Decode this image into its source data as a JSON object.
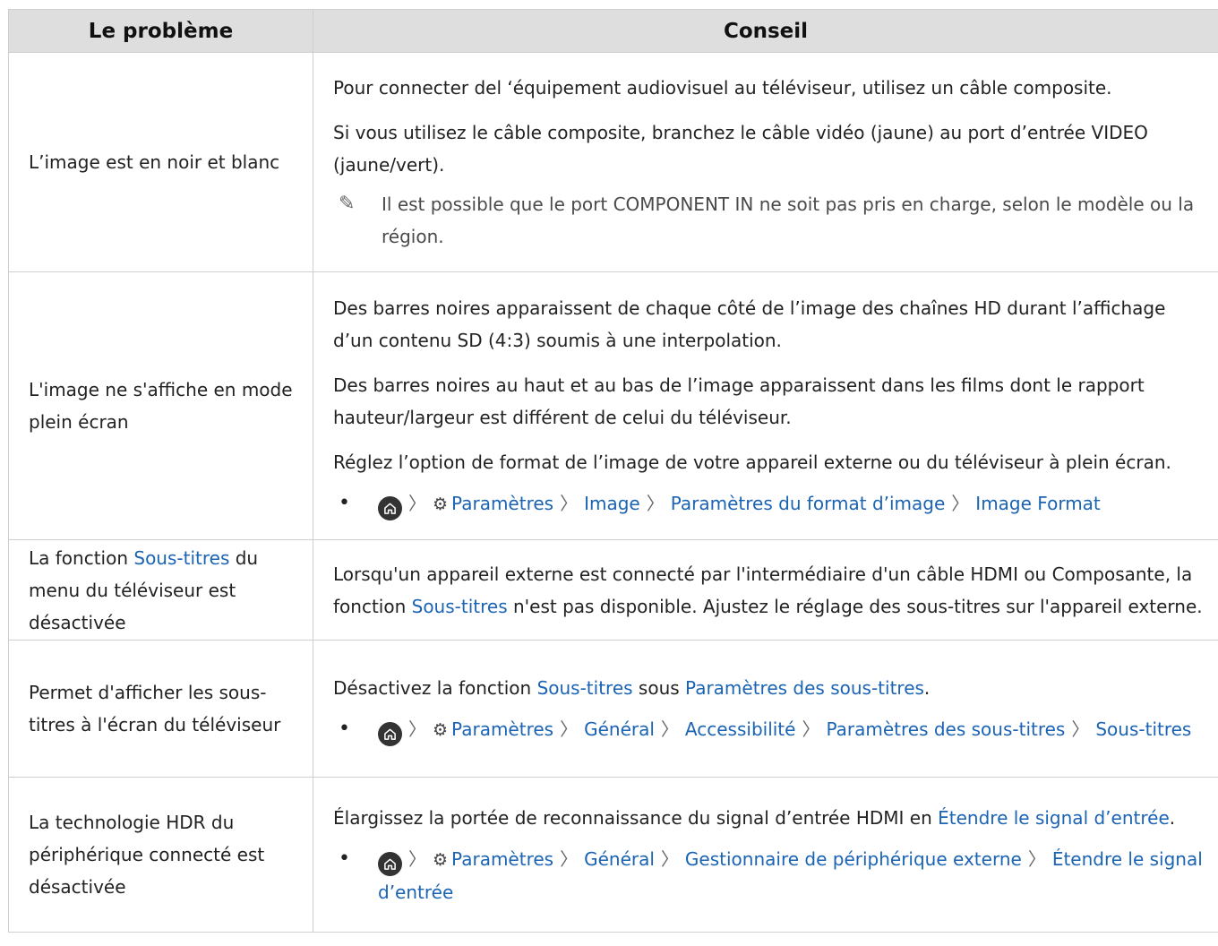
{
  "headers": {
    "problem": "Le problème",
    "advice": "Conseil"
  },
  "rows": [
    {
      "problem": "L’image est en noir et blanc",
      "tips": [
        "Pour connecter del ‘équipement audiovisuel au téléviseur, utilisez un câble composite.",
        "Si vous utilisez le câble composite, branchez le câble vidéo (jaune) au port d’entrée VIDEO (jaune/vert)."
      ],
      "note": "Il est possible que le port COMPONENT IN ne soit pas pris en charge, selon le modèle ou la région."
    },
    {
      "problem": "L'image ne s'affiche en mode plein écran",
      "tips": [
        "Des barres noires apparaissent de chaque côté de l’image des chaînes HD durant l’affichage d’un contenu SD (4:3) soumis à une interpolation.",
        "Des barres noires au haut et au bas de l’image apparaissent dans les films dont le rapport hauteur/largeur est différent de celui du téléviseur.",
        "Réglez l’option de format de l’image de votre appareil externe ou du téléviseur à plein écran."
      ],
      "path": [
        "Paramètres",
        "Image",
        "Paramètres du format d’image",
        "Image Format"
      ]
    },
    {
      "problem_before": "La fonction ",
      "problem_link": "Sous-titres",
      "problem_after": " du menu du téléviseur est désactivée",
      "tip_before": "Lorsqu'un appareil externe est connecté par l'intermédiaire d'un câble HDMI ou Composante, la fonction ",
      "tip_link": "Sous-titres",
      "tip_after": " n'est pas disponible. Ajustez le réglage des sous-titres sur l'appareil externe."
    },
    {
      "problem": "Permet d'afficher les sous-titres à l'écran du téléviseur",
      "tip_before": "Désactivez la fonction ",
      "tip_link1": "Sous-titres",
      "tip_mid": " sous ",
      "tip_link2": "Paramètres des sous-titres",
      "tip_after": ".",
      "path": [
        "Paramètres",
        "Général",
        "Accessibilité",
        "Paramètres des sous-titres",
        "Sous-titres"
      ]
    },
    {
      "problem": "La technologie HDR du périphérique connecté est désactivée",
      "tip_before": "Élargissez la portée de reconnaissance du signal d’entrée HDMI en ",
      "tip_link": "Étendre le signal d’entrée",
      "tip_after": ".",
      "path": [
        "Paramètres",
        "Général",
        "Gestionnaire de périphérique externe",
        "Étendre le signal d’entrée"
      ]
    }
  ],
  "glyphs": {
    "separator": "〉",
    "bullet": "•",
    "note": "✎",
    "gear": "⚙"
  },
  "colors": {
    "link": "#1b63b3",
    "header_bg": "#dedede",
    "border": "#cfcfcf"
  }
}
